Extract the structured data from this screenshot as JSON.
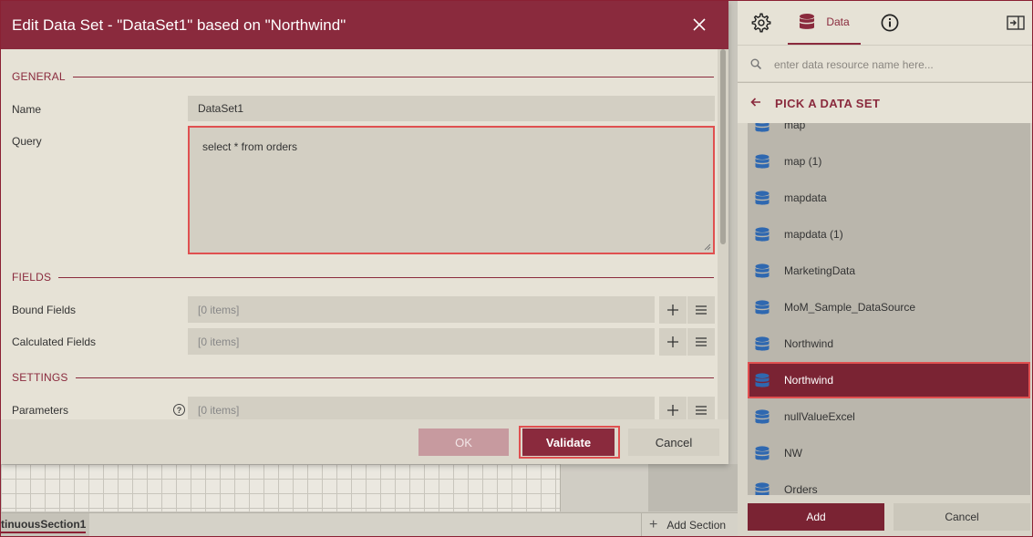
{
  "dialog": {
    "title": "Edit Data Set - \"DataSet1\" based on \"Northwind\"",
    "sections": {
      "general": "GENERAL",
      "fields": "FIELDS",
      "settings": "SETTINGS"
    },
    "name_label": "Name",
    "name_value": "DataSet1",
    "query_label": "Query",
    "query_value": "select * from orders",
    "bound_fields_label": "Bound Fields",
    "bound_fields_value": "[0 items]",
    "calculated_fields_label": "Calculated Fields",
    "calculated_fields_value": "[0 items]",
    "parameters_label": "Parameters",
    "parameters_help": "?",
    "parameters_value": "[0 items]",
    "buttons": {
      "ok": "OK",
      "validate": "Validate",
      "cancel": "Cancel"
    }
  },
  "designer": {
    "section_tab": "tinuousSection1",
    "add_section": "Add Section"
  },
  "panel": {
    "tab_data_label": "Data",
    "search_placeholder": "enter data resource name here...",
    "heading": "PICK A DATA SET",
    "items": [
      {
        "label": "map"
      },
      {
        "label": "map (1)"
      },
      {
        "label": "mapdata"
      },
      {
        "label": "mapdata (1)"
      },
      {
        "label": "MarketingData"
      },
      {
        "label": "MoM_Sample_DataSource"
      },
      {
        "label": "Northwind"
      },
      {
        "label": "Northwind",
        "selected": true
      },
      {
        "label": "nullValueExcel"
      },
      {
        "label": "NW"
      },
      {
        "label": "Orders"
      }
    ],
    "add_button": "Add",
    "cancel_button": "Cancel"
  },
  "colors": {
    "accent": "#8a2a3d",
    "selected_bg": "#7a2333",
    "highlight_border": "#e05050",
    "db_icon": "#2f68b0"
  },
  "icons": [
    "close-icon",
    "gear-icon",
    "database-icon",
    "info-icon",
    "collapse-panel-icon",
    "search-icon",
    "back-arrow-icon",
    "plus-icon",
    "menu-icon",
    "help-icon"
  ]
}
